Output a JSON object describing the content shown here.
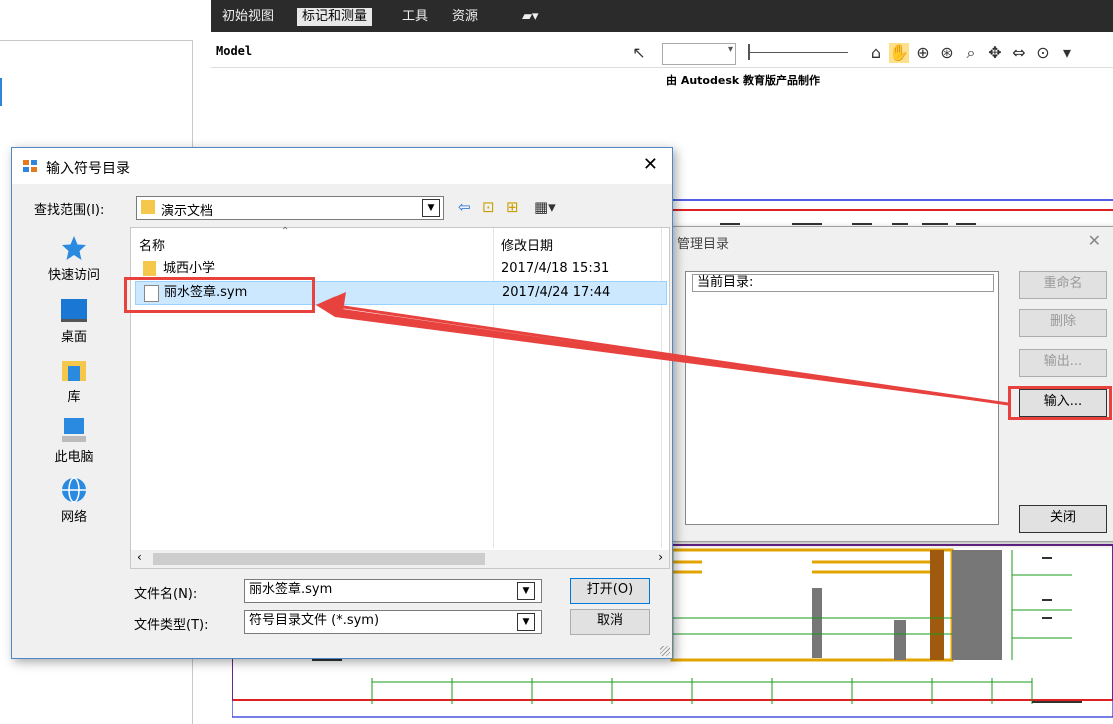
{
  "viewer": {
    "menu": [
      "初始视图",
      "标记和测量",
      "工具",
      "资源"
    ],
    "model_label": "Model",
    "watermark": "由 Autodesk 教育版产品制作"
  },
  "manage_dialog": {
    "title": "管理目录",
    "list_header": "当前目录:",
    "buttons": {
      "rename": "重命名",
      "delete": "删除",
      "export": "输出...",
      "import": "输入...",
      "close": "关闭"
    }
  },
  "import_dialog": {
    "title": "输入符号目录",
    "lookin_label": "查找范围(I):",
    "lookin_value": "演示文档",
    "places": [
      "快速访问",
      "桌面",
      "库",
      "此电脑",
      "网络"
    ],
    "columns": {
      "name": "名称",
      "modified": "修改日期"
    },
    "files": [
      {
        "name": "城西小学",
        "date": "2017/4/18 15:31",
        "type": "folder"
      },
      {
        "name": "丽水签章.sym",
        "date": "2017/4/24 17:44",
        "type": "file"
      }
    ],
    "filename_label": "文件名(N):",
    "filename_value": "丽水签章.sym",
    "filetype_label": "文件类型(T):",
    "filetype_value": "符号目录文件 (*.sym)",
    "open_button": "打开(O)",
    "cancel_button": "取消"
  },
  "colors": {
    "accent": "#0078d7",
    "annotation": "#e8423f",
    "folder": "#f5c84c"
  }
}
